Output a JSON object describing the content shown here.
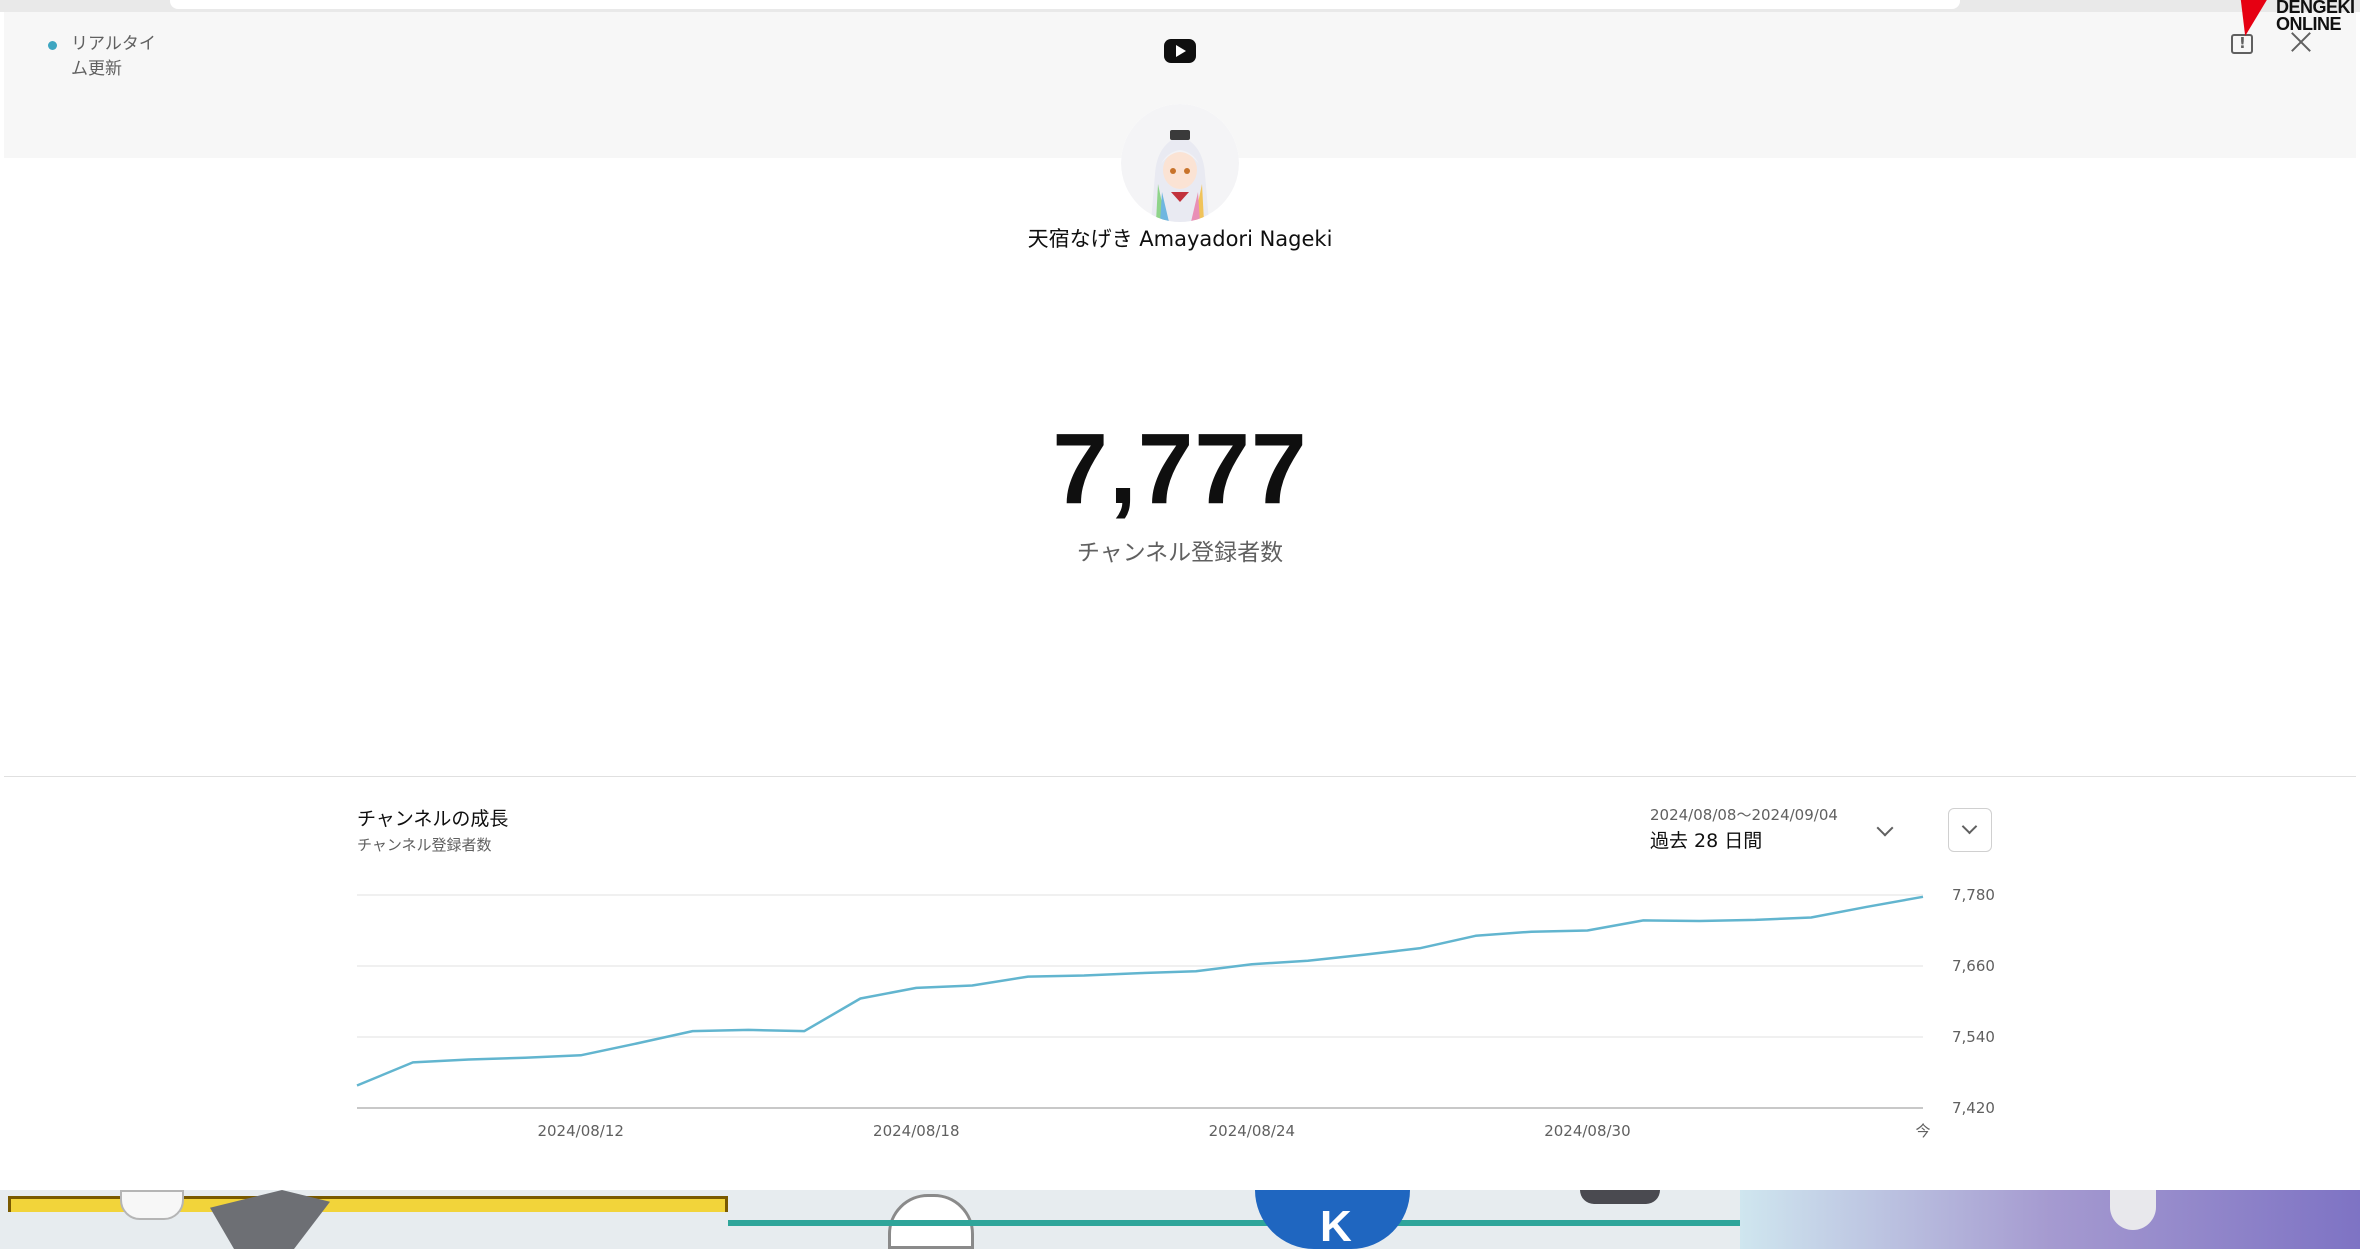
{
  "header": {
    "realtime_label": "リアルタイム更新",
    "logo": {
      "line1": "DENGEKI",
      "line2": "ONLINE"
    }
  },
  "channel": {
    "name": "天宿なげき Amayadori Nageki",
    "subscriber_count": "7,777",
    "subscriber_label": "チャンネル登録者数"
  },
  "growth": {
    "title": "チャンネルの成長",
    "subtitle": "チャンネル登録者数",
    "date_range": "2024/08/08～2024/09/04",
    "period_label": "過去 28 日間"
  },
  "chart_data": {
    "type": "line",
    "series": [
      {
        "values": [
          7458,
          7497,
          7502,
          7505,
          7509,
          7529,
          7550,
          7552,
          7550,
          7605,
          7623,
          7627,
          7642,
          7644,
          7648,
          7651,
          7663,
          7669,
          7679,
          7690,
          7711,
          7718,
          7720,
          7737,
          7736,
          7738,
          7742,
          7760,
          7777
        ]
      }
    ],
    "x_ticks": [
      "2024/08/12",
      "2024/08/18",
      "2024/08/24",
      "2024/08/30",
      "今"
    ],
    "x_tick_index": [
      4,
      10,
      16,
      22,
      28
    ],
    "y_ticks": [
      "7,420",
      "7,540",
      "7,660",
      "7,780"
    ],
    "ylim": [
      7420,
      7780
    ],
    "grid": true,
    "colors": {
      "line": "#62b5cf",
      "grid": "#ececec",
      "axis": "#c8c8c8"
    }
  },
  "colors": {
    "accent": "#3ea6c1",
    "brand_red": "#e60012"
  }
}
